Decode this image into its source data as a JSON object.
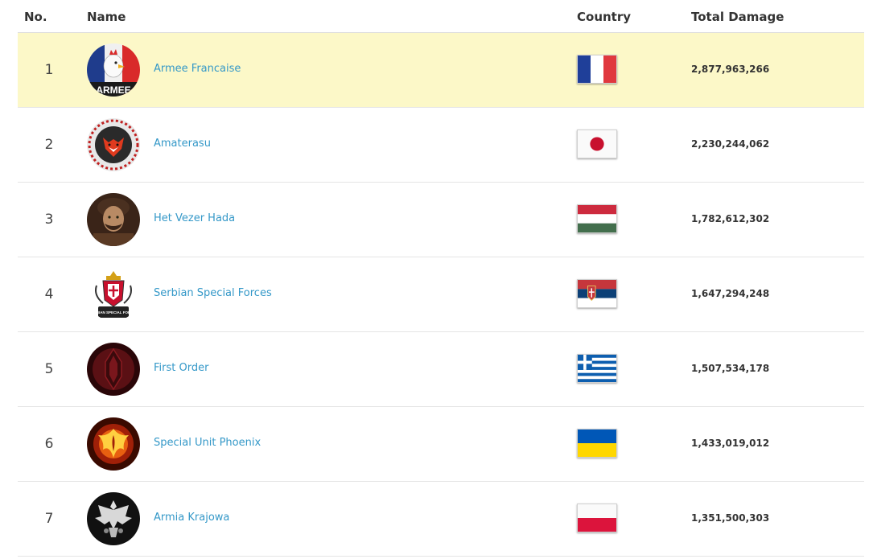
{
  "table": {
    "headers": {
      "no": "No.",
      "name": "Name",
      "country": "Country",
      "damage": "Total Damage"
    },
    "rows": [
      {
        "rank": "1",
        "name": "Armee Francaise",
        "damage": "2,877,963,266",
        "flag": "france-flag-icon",
        "avatar": "armee-francaise-logo",
        "highlight": true
      },
      {
        "rank": "2",
        "name": "Amaterasu",
        "damage": "2,230,244,062",
        "flag": "japan-flag-icon",
        "avatar": "amaterasu-logo",
        "highlight": false
      },
      {
        "rank": "3",
        "name": "Het Vezer Hada",
        "damage": "1,782,612,302",
        "flag": "hungary-flag-icon",
        "avatar": "het-vezer-hada-logo",
        "highlight": false
      },
      {
        "rank": "4",
        "name": "Serbian Special Forces",
        "damage": "1,647,294,248",
        "flag": "serbia-flag-icon",
        "avatar": "serbian-special-forces-logo",
        "highlight": false
      },
      {
        "rank": "5",
        "name": "First Order",
        "damage": "1,507,534,178",
        "flag": "greece-flag-icon",
        "avatar": "first-order-logo",
        "highlight": false
      },
      {
        "rank": "6",
        "name": "Special Unit Phoenix",
        "damage": "1,433,019,012",
        "flag": "ukraine-flag-icon",
        "avatar": "special-unit-phoenix-logo",
        "highlight": false
      },
      {
        "rank": "7",
        "name": "Armia Krajowa",
        "damage": "1,351,500,303",
        "flag": "poland-flag-icon",
        "avatar": "armia-krajowa-logo",
        "highlight": false
      }
    ]
  },
  "avatar_text": {
    "armee": "ARMEE",
    "serbian": "SERBIAN SPECIAL FORCES"
  },
  "colors": {
    "highlight_row": "#fcf8c8",
    "link": "#3498c8"
  }
}
